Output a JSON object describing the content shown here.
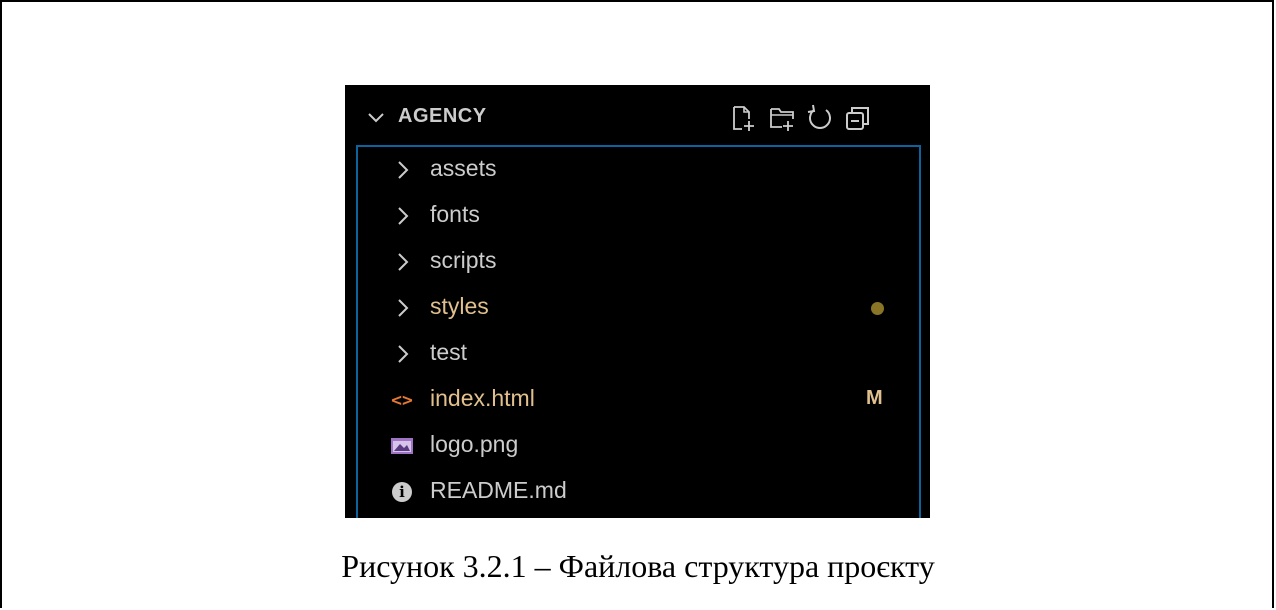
{
  "explorer": {
    "folder_name": "AGENCY",
    "toolbar": [
      {
        "name": "new-file-icon",
        "tooltip": "New File"
      },
      {
        "name": "new-folder-icon",
        "tooltip": "New Folder"
      },
      {
        "name": "refresh-icon",
        "tooltip": "Refresh Explorer"
      },
      {
        "name": "collapse-all-icon",
        "tooltip": "Collapse Folders in Explorer"
      }
    ],
    "items": [
      {
        "label": "assets",
        "kind": "folder",
        "status": ""
      },
      {
        "label": "fonts",
        "kind": "folder",
        "status": ""
      },
      {
        "label": "scripts",
        "kind": "folder",
        "status": ""
      },
      {
        "label": "styles",
        "kind": "folder",
        "status": "dot"
      },
      {
        "label": "test",
        "kind": "folder",
        "status": ""
      },
      {
        "label": "index.html",
        "kind": "html-file",
        "status": "M"
      },
      {
        "label": "logo.png",
        "kind": "image-file",
        "status": ""
      },
      {
        "label": "README.md",
        "kind": "info-file",
        "status": ""
      }
    ],
    "colors": {
      "background": "#000000",
      "text": "#cccccc",
      "modified": "#e2c08d",
      "focus_border": "#0e639c",
      "html_icon": "#e37933",
      "image_icon": "#a074c4"
    }
  },
  "caption": "Рисунок 3.2.1 – Файлова структура проєкту"
}
